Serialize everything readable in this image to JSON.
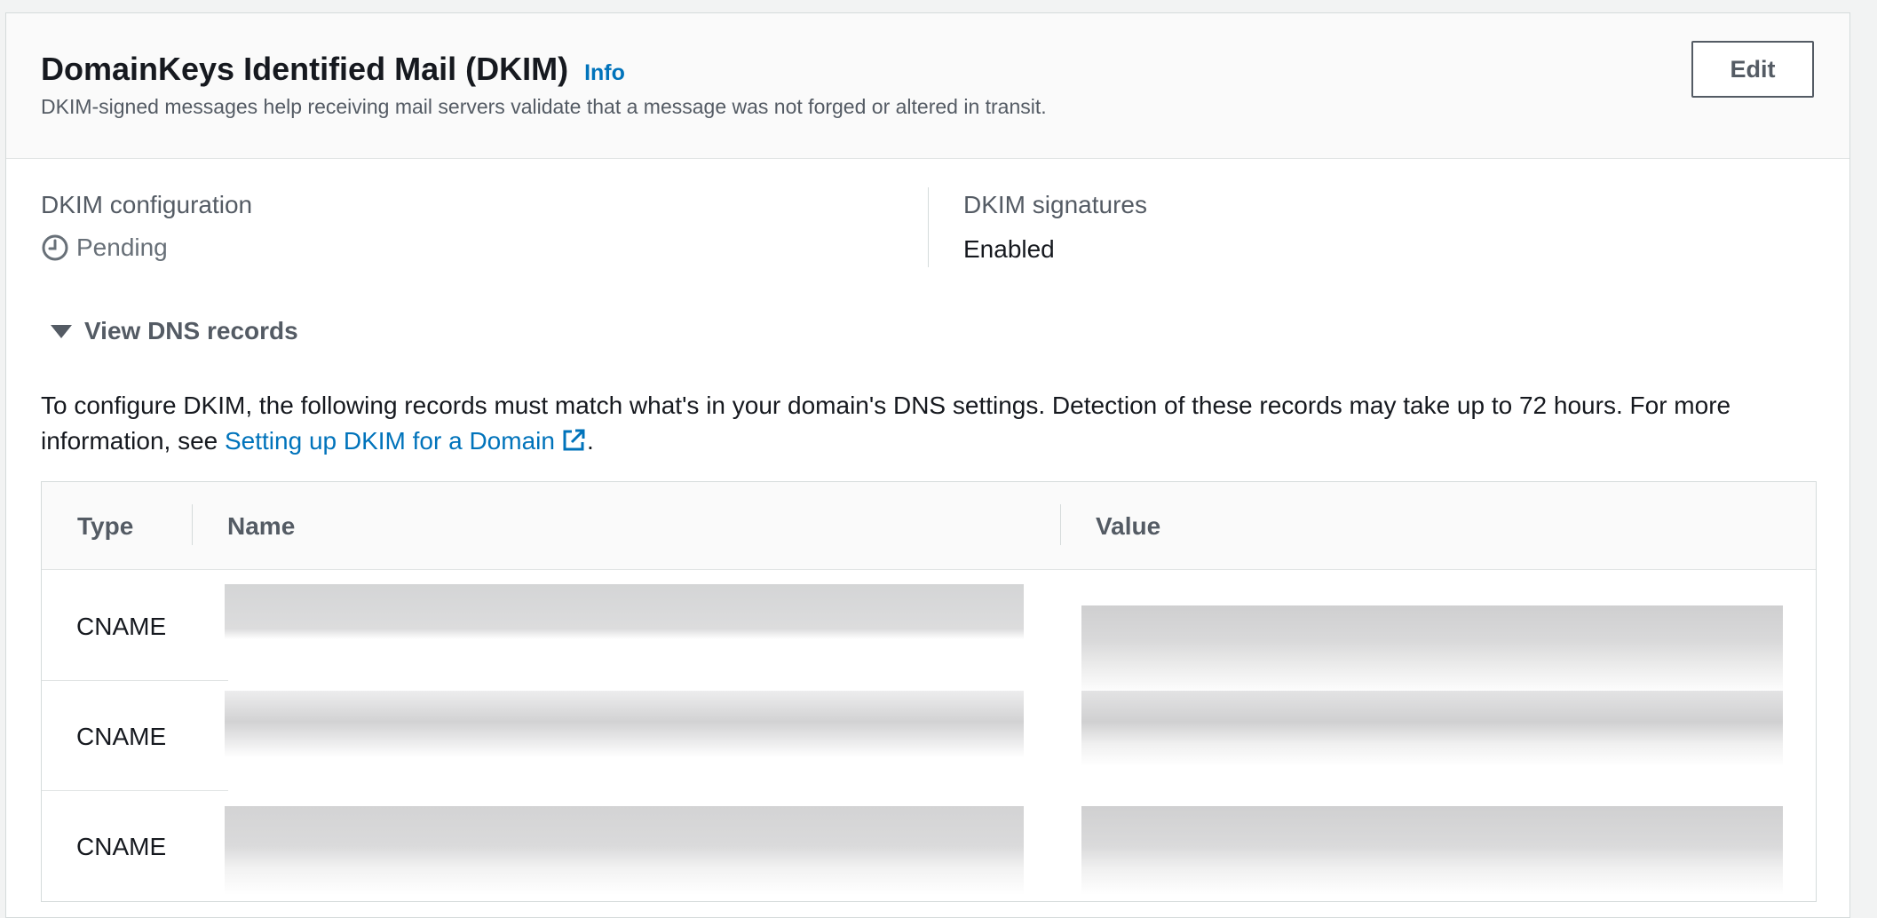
{
  "header": {
    "title": "DomainKeys Identified Mail (DKIM)",
    "info_label": "Info",
    "subtitle": "DKIM-signed messages help receiving mail servers validate that a message was not forged or altered in transit.",
    "edit_label": "Edit"
  },
  "config": {
    "label": "DKIM configuration",
    "status": "Pending",
    "status_icon": "clock-icon"
  },
  "signatures": {
    "label": "DKIM signatures",
    "value": "Enabled"
  },
  "dns": {
    "expander_label": "View DNS records",
    "description_prefix": "To configure DKIM, the following records must match what's in your domain's DNS settings. Detection of these records may take up to 72 hours. For more information, see ",
    "link_text": "Setting up DKIM for a Domain",
    "description_suffix": ".",
    "columns": [
      "Type",
      "Name",
      "Value"
    ],
    "rows": [
      {
        "type": "CNAME",
        "name": "",
        "value": ""
      },
      {
        "type": "CNAME",
        "name": "",
        "value": ""
      },
      {
        "type": "CNAME",
        "name": "",
        "value": ""
      }
    ]
  },
  "colors": {
    "link": "#0073bb",
    "text_secondary": "#545b64",
    "border": "#d5dbdb"
  }
}
